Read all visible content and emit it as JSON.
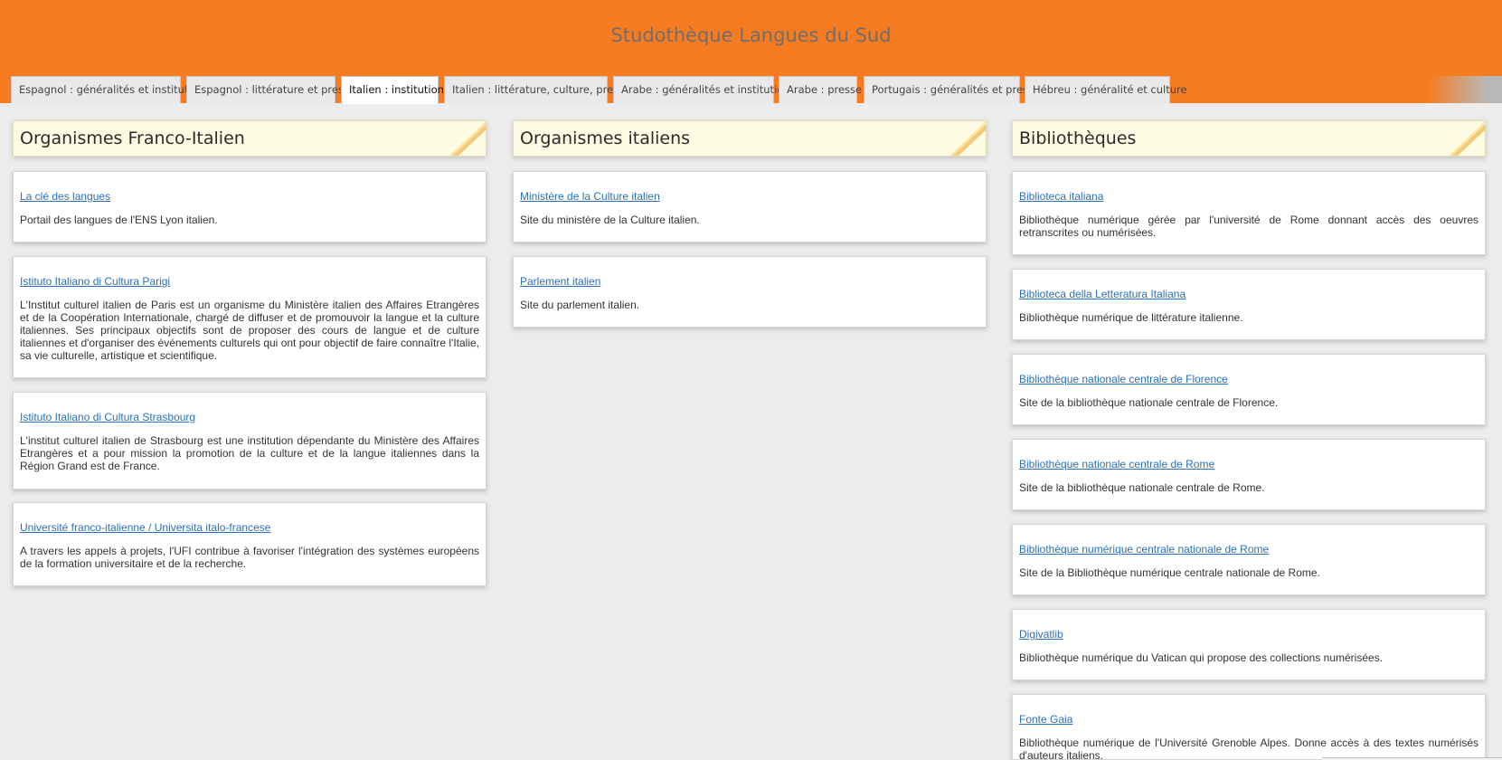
{
  "site": {
    "title": "Studothèque Langues du Sud"
  },
  "tabs": [
    {
      "label": "Espagnol : généralités et institution"
    },
    {
      "label": "Espagnol : littérature et presse"
    },
    {
      "label": "Italien : institutions"
    },
    {
      "label": "Italien : littérature, culture, presse"
    },
    {
      "label": "Arabe : généralités et institutions"
    },
    {
      "label": "Arabe : presse"
    },
    {
      "label": "Portugais : généralités et presse"
    },
    {
      "label": "Hébreu : généralité et culture"
    }
  ],
  "active_tab": "Italien : institutions",
  "colors": {
    "header": "#f77b20",
    "link": "#2a6fb8",
    "panel_head": "#fdfce3"
  },
  "columns": [
    {
      "title": "Organismes Franco-Italien",
      "cards": [
        {
          "link": "La clé des langues",
          "text": "Portail des langues de l'ENS Lyon italien."
        },
        {
          "link": "Istituto Italiano di Cultura Parigi",
          "text": "L'Institut culturel italien de Paris est un organisme du Ministère italien des Affaires Etrangères et de la Coopération Internationale, chargé de diffuser et de promouvoir la langue et la culture italiennes. Ses principaux objectifs sont de proposer des cours de langue et de culture italiennes et d'organiser des événements culturels qui ont pour objectif de faire connaître l'Italie, sa vie culturelle, artistique et scientifique."
        },
        {
          "link": "Istituto Italiano di Cultura Strasbourg",
          "text": "L'institut culturel italien de Strasbourg est une institution dépendante du Ministère des Affaires Etrangères et a pour mission la promotion de la culture et de la langue italiennes dans la Région Grand est de France."
        },
        {
          "link": "Université franco-italienne / Universita italo-francese",
          "text": "A travers les appels à projets, l'UFI contribue à favoriser l'intégration des systèmes européens de la formation universitaire et de la recherche."
        }
      ]
    },
    {
      "title": "Organismes italiens",
      "cards": [
        {
          "link": "Ministère de la Culture italien",
          "text": "Site du ministère de la Culture italien."
        },
        {
          "link": "Parlement italien",
          "text": "Site du parlement italien."
        }
      ]
    },
    {
      "title": "Bibliothèques",
      "cards": [
        {
          "link": "Biblioteca italiana",
          "text": "Bibliothèque numérique gérée par l'université de Rome donnant accès des oeuvres retranscrites ou numérisées."
        },
        {
          "link": "Biblioteca della Letteratura Italiana",
          "text": "Bibliothèque numérique de littérature italienne."
        },
        {
          "link": "Bibliothèque nationale centrale de Florence",
          "text": "Site de la bibliothèque nationale centrale de Florence."
        },
        {
          "link": "Bibliothèque nationale centrale de Rome",
          "text": "Site de la bibliothèque nationale centrale de Rome."
        },
        {
          "link": "Bibliothèque numérique centrale nationale de Rome",
          "text": "Site de la Bibliothèque numérique centrale nationale de Rome."
        },
        {
          "link": "Digivatlib",
          "text": "Bibliothèque numérique du Vatican qui propose des collections numérisées."
        },
        {
          "link": "Fonte Gaia",
          "text": "Bibliothèque numérique de l'Université Grenoble Alpes. Donne accès à des textes numérisés d'auteurs italiens."
        }
      ]
    }
  ]
}
